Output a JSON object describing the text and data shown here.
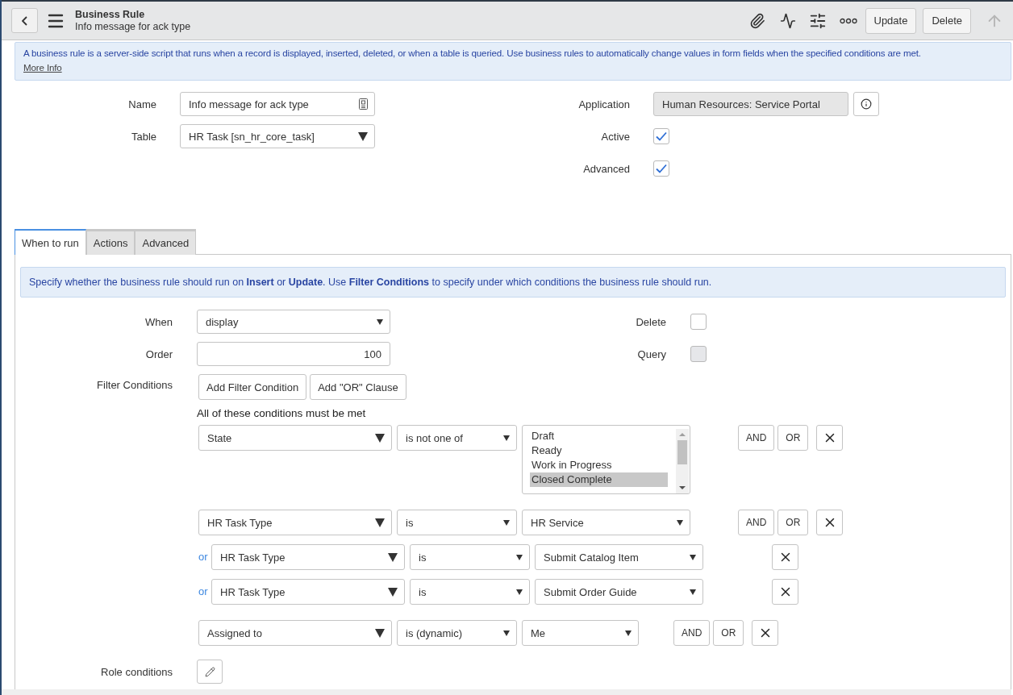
{
  "header": {
    "title": "Business Rule",
    "subtitle": "Info message for ack type",
    "buttons": [
      "Update",
      "Delete"
    ]
  },
  "intro": {
    "text": "A business rule is a server-side script that runs when a record is displayed, inserted, deleted, or when a table is queried. Use business rules to automatically change values in form fields when the specified conditions are met.",
    "link": "More Info"
  },
  "fields_left": [
    {
      "label": "Name",
      "kind": "text",
      "value": "Info message for ack type"
    },
    {
      "label": "Table",
      "kind": "select",
      "value": "HR Task [sn_hr_core_task]"
    }
  ],
  "fields_right": [
    {
      "label": "Application",
      "kind": "readonly",
      "value": "Human Resources: Service Portal"
    },
    {
      "label": "Active",
      "kind": "checkbox",
      "checked": true,
      "disabled": false
    },
    {
      "label": "Advanced",
      "kind": "checkbox",
      "checked": true,
      "disabled": false
    }
  ],
  "tabs": [
    {
      "label": "When to run",
      "selected": true
    },
    {
      "label": "Actions",
      "selected": false
    },
    {
      "label": "Advanced",
      "selected": false
    }
  ],
  "panel": {
    "info": "Specify whether the business rule should run on **Insert** or **Update**. Use **Filter Conditions** to specify under which conditions the business rule should run.",
    "rows": [
      {
        "label": "When",
        "kind": "select",
        "value": "display",
        "side": {
          "label": "Delete",
          "checked": false,
          "disabled": false
        }
      },
      {
        "label": "Order",
        "kind": "number",
        "value": "100",
        "side": {
          "label": "Query",
          "checked": false,
          "disabled": true
        }
      }
    ],
    "filter": {
      "label": "Filter Conditions",
      "buttons": [
        "Add Filter Condition",
        "Add \"OR\" Clause"
      ],
      "note": "All of these conditions must be met",
      "conditions": [
        {
          "field": "State",
          "operator": "is not one of",
          "kind": "list",
          "options": [
            {
              "label": "Draft",
              "selected": false
            },
            {
              "label": "Ready",
              "selected": false
            },
            {
              "label": "Work in Progress",
              "selected": false
            },
            {
              "label": "Closed Complete",
              "selected": true
            }
          ],
          "actions": [
            "AND",
            "OR"
          ]
        },
        {
          "field": "HR Task Type",
          "operator": "is",
          "kind": "select",
          "value": "HR Service",
          "actions": [
            "AND",
            "OR"
          ]
        },
        {
          "connector": "or",
          "field": "HR Task Type",
          "operator": "is",
          "kind": "select",
          "value": "Submit Catalog Item"
        },
        {
          "connector": "or",
          "field": "HR Task Type",
          "operator": "is",
          "kind": "select",
          "value": "Submit Order Guide"
        },
        {
          "field": "Assigned to",
          "operator": "is (dynamic)",
          "kind": "short",
          "value": "Me",
          "actions": [
            "AND",
            "OR"
          ]
        }
      ]
    },
    "role_conditions": {
      "label": "Role conditions"
    }
  }
}
